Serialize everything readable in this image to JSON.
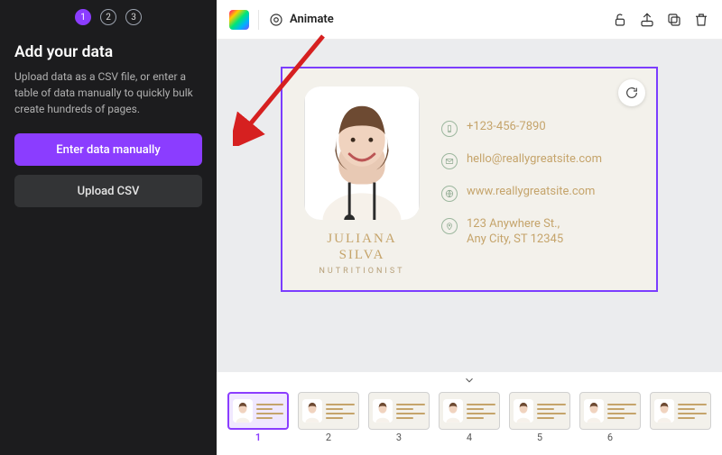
{
  "sidebar": {
    "steps": {
      "current": 1,
      "total": 3
    },
    "title": "Add your data",
    "description": "Upload data as a CSV file, or enter a table of data manually to quickly bulk create hundreds of pages.",
    "enter_manually_label": "Enter data manually",
    "upload_csv_label": "Upload CSV"
  },
  "toolbar": {
    "animate_label": "Animate"
  },
  "card": {
    "name": "JULIANA SILVA",
    "role": "NUTRITIONIST",
    "phone": "+123-456-7890",
    "email": "hello@reallygreatsite.com",
    "website": "www.reallygreatsite.com",
    "address_line1": "123 Anywhere St.,",
    "address_line2": "Any City, ST 12345"
  },
  "thumbnails": {
    "labels": [
      "1",
      "2",
      "3",
      "4",
      "5",
      "6"
    ],
    "active_index": 0
  }
}
